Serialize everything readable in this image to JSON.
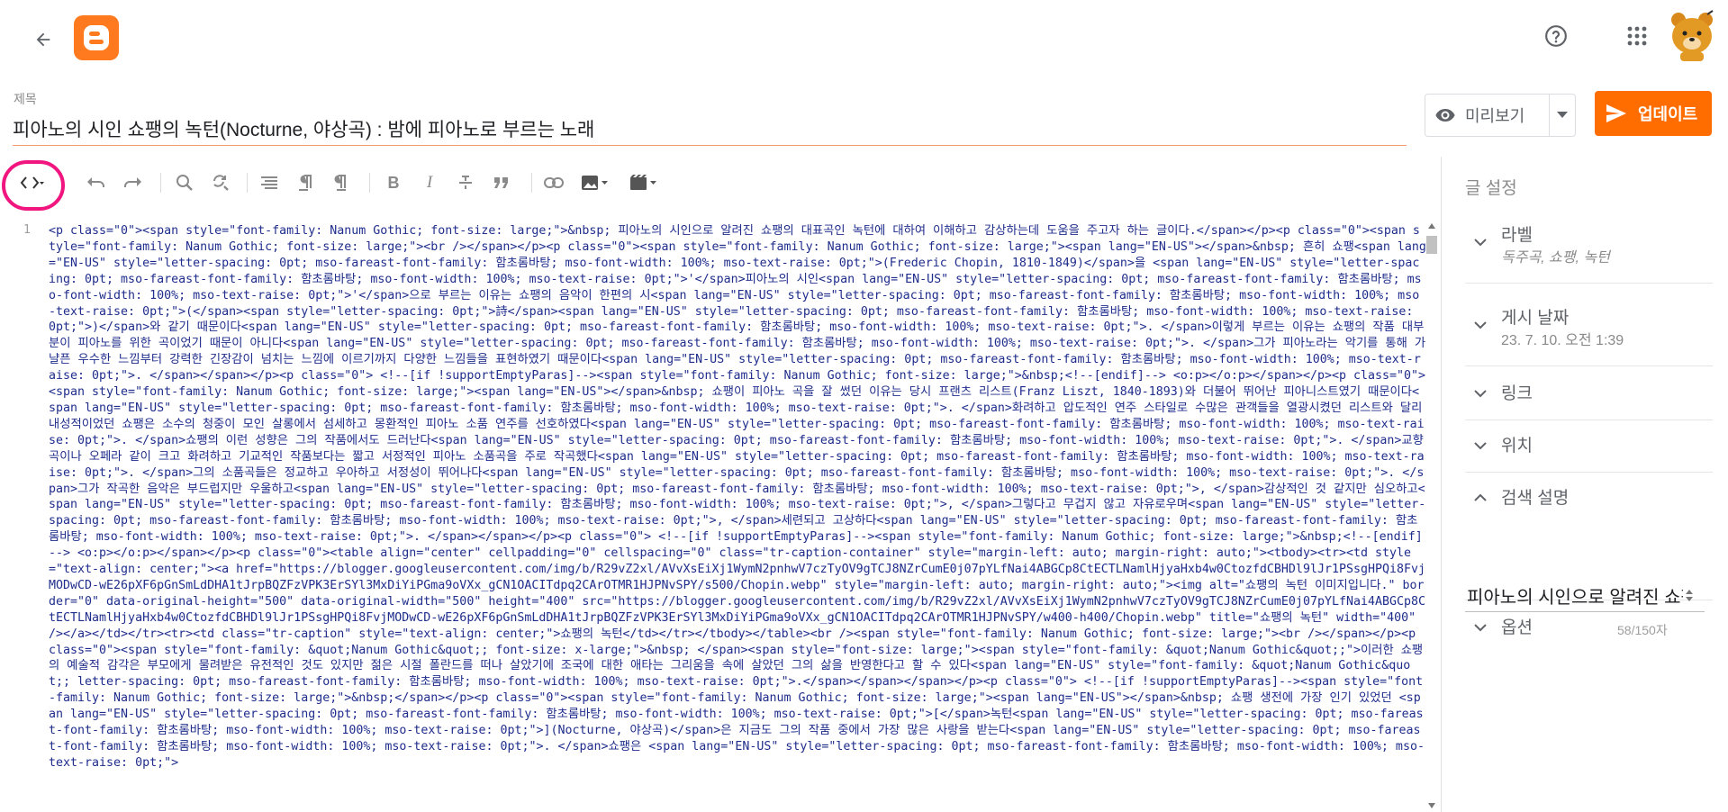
{
  "header": {
    "back_icon": "arrow-back-icon",
    "logo_icon": "blogger-logo-icon",
    "help_icon": "help-circle-icon",
    "apps_icon": "apps-grid-icon",
    "avatar_icon": "avatar-bear-icon"
  },
  "post": {
    "title_label": "제목",
    "title": "피아노의 시인 쇼팽의 녹턴(Nocturne, 야상곡) : 밤에 피아노로 부르는 노래"
  },
  "actions": {
    "preview_label": "미리보기",
    "update_label": "업데이트"
  },
  "toolbar": {
    "items": [
      "html-view-toggle",
      "undo",
      "redo",
      "search",
      "find-replace",
      "format",
      "paragraph-ltr",
      "paragraph-rtl",
      "bold",
      "italic",
      "strikethrough",
      "quote",
      "link",
      "insert-image",
      "insert-video"
    ]
  },
  "editor": {
    "line_number": "1",
    "code": "<p class=\"0\"><span style=\"font-family: Nanum Gothic; font-size: large;\">&nbsp; 피아노의 시인으로 알려진 쇼팽의 대표곡인 녹턴에 대하여 이해하고 감상하는데 도움을 주고자 하는 글이다.</span></p><p class=\"0\"><span style=\"font-family: Nanum Gothic; font-size: large;\"><br /></span></p><p class=\"0\"><span style=\"font-family: Nanum Gothic; font-size: large;\"><span lang=\"EN-US\"></span>&nbsp; 흔히 쇼팽<span lang=\"EN-US\" style=\"letter-spacing: 0pt; mso-fareast-font-family: 함초롬바탕; mso-font-width: 100%; mso-text-raise: 0pt;\">(Frederic Chopin, 1810-1849)</span>을 <span lang=\"EN-US\" style=\"letter-spacing: 0pt; mso-fareast-font-family: 함초롬바탕; mso-font-width: 100%; mso-text-raise: 0pt;\">'</span>피아노의 시인<span lang=\"EN-US\" style=\"letter-spacing: 0pt; mso-fareast-font-family: 함초롬바탕; mso-font-width: 100%; mso-text-raise: 0pt;\">'</span>으로 부르는 이유는 쇼팽의 음악이 한편의 시<span lang=\"EN-US\" style=\"letter-spacing: 0pt; mso-fareast-font-family: 함초롬바탕; mso-font-width: 100%; mso-text-raise: 0pt;\">(</span><span style=\"letter-spacing: 0pt;\">詩</span><span lang=\"EN-US\" style=\"letter-spacing: 0pt; mso-fareast-font-family: 함초롬바탕; mso-font-width: 100%; mso-text-raise: 0pt;\">)</span>와 같기 때문이다<span lang=\"EN-US\" style=\"letter-spacing: 0pt; mso-fareast-font-family: 함초롬바탕; mso-font-width: 100%; mso-text-raise: 0pt;\">. </span>이렇게 부르는 이유는 쇼팽의 작품 대부분이 피아노를 위한 곡이었기 때문이 아니다<span lang=\"EN-US\" style=\"letter-spacing: 0pt; mso-fareast-font-family: 함초롬바탕; mso-font-width: 100%; mso-text-raise: 0pt;\">. </span>그가 피아노라는 악기를 통해 가냘픈 우수한 느낌부터 강력한 긴장감이 넘치는 느낌에 이르기까지 다양한 느낌들을 표현하였기 때문이다<span lang=\"EN-US\" style=\"letter-spacing: 0pt; mso-fareast-font-family: 함초롬바탕; mso-font-width: 100%; mso-text-raise: 0pt;\">. </span></span></p><p class=\"0\"> <!--[if !supportEmptyParas]--><span style=\"font-family: Nanum Gothic; font-size: large;\">&nbsp;<!--[endif]--> <o:p></o:p></span></p><p class=\"0\"><span style=\"font-family: Nanum Gothic; font-size: large;\"><span lang=\"EN-US\"></span>&nbsp; 쇼팽이 피아노 곡을 잘 썼던 이유는 당시 프랜츠 리스트(Franz Liszt, 1840-1893)와 더불어 뛰어난 피아니스트였기 때문이다<span lang=\"EN-US\" style=\"letter-spacing: 0pt; mso-fareast-font-family: 함초롬바탕; mso-font-width: 100%; mso-text-raise: 0pt;\">. </span>화려하고 압도적인 연주 스타일로 수많은 관객들을 열광시켰던 리스트와 달리 내성적이었던 쇼팽은 소수의 청중이 모인 살롱에서 섬세하고 몽환적인 피아노 소품 연주를 선호하였다<span lang=\"EN-US\" style=\"letter-spacing: 0pt; mso-fareast-font-family: 함초롬바탕; mso-font-width: 100%; mso-text-raise: 0pt;\">. </span>쇼팽의 이런 성향은 그의 작품에서도 드러난다<span lang=\"EN-US\" style=\"letter-spacing: 0pt; mso-fareast-font-family: 함초롬바탕; mso-font-width: 100%; mso-text-raise: 0pt;\">. </span>교향곡이나 오페라 같이 크고 화려하고 기교적인 작품보다는 짧고 서정적인 피아노 소품곡을 주로 작곡했다<span lang=\"EN-US\" style=\"letter-spacing: 0pt; mso-fareast-font-family: 함초롬바탕; mso-font-width: 100%; mso-text-raise: 0pt;\">. </span>그의 소품곡들은 정교하고 우아하고 서정성이 뛰어나다<span lang=\"EN-US\" style=\"letter-spacing: 0pt; mso-fareast-font-family: 함초롬바탕; mso-font-width: 100%; mso-text-raise: 0pt;\">. </span>그가 작곡한 음악은 부드럽지만 우울하고<span lang=\"EN-US\" style=\"letter-spacing: 0pt; mso-fareast-font-family: 함초롬바탕; mso-font-width: 100%; mso-text-raise: 0pt;\">, </span>감상적인 것 같지만 심오하고<span lang=\"EN-US\" style=\"letter-spacing: 0pt; mso-fareast-font-family: 함초롬바탕; mso-font-width: 100%; mso-text-raise: 0pt;\">, </span>그렇다고 무겁지 않고 자유로우며<span lang=\"EN-US\" style=\"letter-spacing: 0pt; mso-fareast-font-family: 함초롬바탕; mso-font-width: 100%; mso-text-raise: 0pt;\">, </span>세련되고 고상하다<span lang=\"EN-US\" style=\"letter-spacing: 0pt; mso-fareast-font-family: 함초롬바탕; mso-font-width: 100%; mso-text-raise: 0pt;\">. </span></span></p><p class=\"0\"> <!--[if !supportEmptyParas]--><span style=\"font-family: Nanum Gothic; font-size: large;\">&nbsp;<!--[endif]--> <o:p></o:p></span></p><p class=\"0\"><table align=\"center\" cellpadding=\"0\" cellspacing=\"0\" class=\"tr-caption-container\" style=\"margin-left: auto; margin-right: auto;\"><tbody><tr><td style=\"text-align: center;\"><a href=\"https://blogger.googleusercontent.com/img/b/R29vZ2xl/AVvXsEiXj1WymN2pnhwV7czTyOV9gTCJ8NZrCumE0j07pYLfNai4ABGCp8CtECTLNamlHjyaHxb4w0CtozfdCBHDl9lJr1PSsgHPQi8FvjMODwCD-wE26pXF6pGnSmLdDHA1tJrpBQZFzVPK3ErSYl3MxDiYiPGma9oVXx_gCN1OACITdpq2CArOTMR1HJPNvSPY/s500/Chopin.webp\" style=\"margin-left: auto; margin-right: auto;\"><img alt=\"쇼팽의 녹턴 이미지입니다.\" border=\"0\" data-original-height=\"500\" data-original-width=\"500\" height=\"400\" src=\"https://blogger.googleusercontent.com/img/b/R29vZ2xl/AVvXsEiXj1WymN2pnhwV7czTyOV9gTCJ8NZrCumE0j07pYLfNai4ABGCp8CtECTLNamlHjyaHxb4w0CtozfdCBHDl9lJr1PSsgHPQi8FvjMODwCD-wE26pXF6pGnSmLdDHA1tJrpBQZFzVPK3ErSYl3MxDiYiPGma9oVXx_gCN1OACITdpq2CArOTMR1HJPNvSPY/w400-h400/Chopin.webp\" title=\"쇼팽의 녹턴\" width=\"400\" /></a></td></tr><tr><td class=\"tr-caption\" style=\"text-align: center;\">쇼팽의 녹턴</td></tr></tbody></table><br /><span style=\"font-family: Nanum Gothic; font-size: large;\"><br /></span></p><p class=\"0\"><span style=\"font-family: &quot;Nanum Gothic&quot;; font-size: x-large;\">&nbsp; </span><span style=\"font-size: large;\"><span style=\"font-family: &quot;Nanum Gothic&quot;;\">이러한 쇼팽의 예술적 감각은 부모에게 물려받은 유전적인 것도 있지만 젊은 시절 폴란드를 떠나 살았기에 조국에 대한 애타는 그리움을 속에 살았던 그의 삶을 반영한다고 할 수 있다<span lang=\"EN-US\" style=\"font-family: &quot;Nanum Gothic&quot;; letter-spacing: 0pt; mso-fareast-font-family: 함초롬바탕; mso-font-width: 100%; mso-text-raise: 0pt;\">.</span></span></span></p><p class=\"0\"> <!--[if !supportEmptyParas]--><span style=\"font-family: Nanum Gothic; font-size: large;\">&nbsp;</span></p><p class=\"0\"><span style=\"font-family: Nanum Gothic; font-size: large;\"><span lang=\"EN-US\"></span>&nbsp; 쇼팽 생전에 가장 인기 있었던 <span lang=\"EN-US\" style=\"letter-spacing: 0pt; mso-fareast-font-family: 함초롬바탕; mso-font-width: 100%; mso-text-raise: 0pt;\">[</span>녹턴<span lang=\"EN-US\" style=\"letter-spacing: 0pt; mso-fareast-font-family: 함초롬바탕; mso-font-width: 100%; mso-text-raise: 0pt;\">](Nocturne, 야상곡)</span>은 지금도 그의 작품 중에서 가장 많은 사랑을 받는다<span lang=\"EN-US\" style=\"letter-spacing: 0pt; mso-fareast-font-family: 함초롬바탕; mso-font-width: 100%; mso-text-raise: 0pt;\">. </span>쇼팽은 <span lang=\"EN-US\" style=\"letter-spacing: 0pt; mso-fareast-font-family: 함초롬바탕; mso-font-width: 100%; mso-text-raise: 0pt;\">"
  },
  "settings": {
    "title": "글 설정",
    "labels": {
      "title": "라벨",
      "value": "독주곡, 쇼팽, 녹턴"
    },
    "publish_date": {
      "title": "게시 날짜",
      "value": "23. 7. 10. 오전 1:39"
    },
    "link": {
      "title": "링크"
    },
    "location": {
      "title": "위치"
    },
    "search_description": {
      "title": "검색 설명",
      "value": "피아노의 시인으로 알려진 쇼팽의 대표곡인 녹턴에 대하여 이해하고 감상하는데 도움을 주고자 하는 글이다.",
      "counter": "58/150자"
    },
    "options": {
      "title": "옵션"
    }
  },
  "colors": {
    "accent": "#ff6d00",
    "highlight_ring": "#f0157f",
    "code_tag": "#1f2d8c"
  }
}
